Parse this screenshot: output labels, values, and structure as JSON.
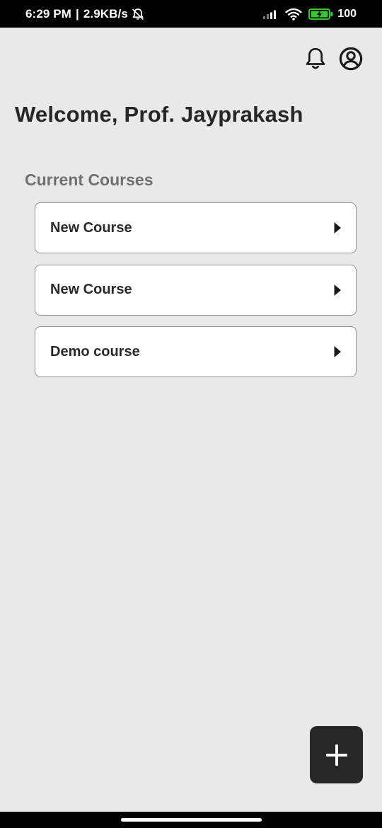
{
  "status_bar": {
    "time": "6:29 PM",
    "separator": "|",
    "network_speed": "2.9KB/s",
    "battery": "100",
    "battery_icon": "battery-charging-icon",
    "signal_icon": "signal-icon",
    "wifi_icon": "wifi-icon",
    "mute_icon": "notifications-muted-icon"
  },
  "header": {
    "notifications_icon": "bell-icon",
    "profile_icon": "account-circle-icon"
  },
  "welcome": {
    "title": "Welcome, Prof. Jayprakash"
  },
  "courses": {
    "heading": "Current Courses",
    "items": [
      {
        "name": "New Course"
      },
      {
        "name": "New Course"
      },
      {
        "name": "Demo course"
      }
    ]
  },
  "fab": {
    "icon": "plus-icon"
  },
  "colors": {
    "background": "#e9e9e9",
    "card": "#ffffff",
    "card_border": "#8f8f8f",
    "text_primary": "#262626",
    "text_secondary": "#707070",
    "fab": "#262626",
    "battery_accent": "#39c535"
  }
}
